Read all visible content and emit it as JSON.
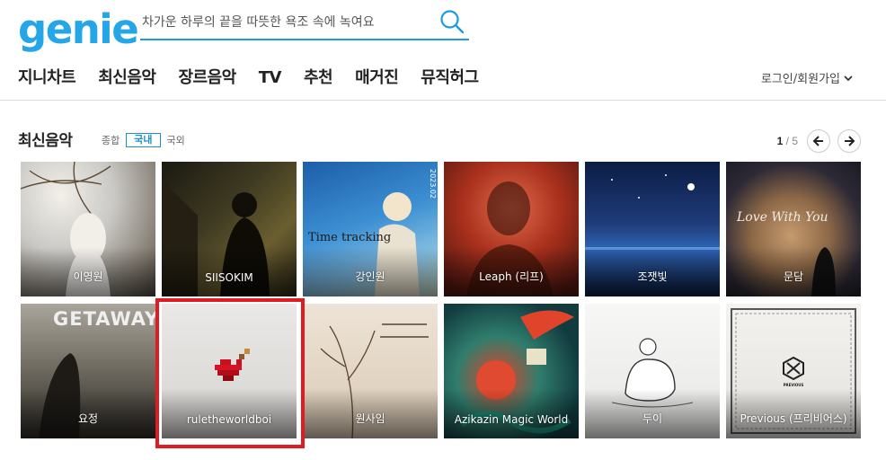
{
  "header": {
    "logo": "genie",
    "search_placeholder": "차가운 하루의 끝을 따뜻한 욕조 속에 녹여요"
  },
  "nav": {
    "items": [
      "지니차트",
      "최신음악",
      "장르음악",
      "TV",
      "추천",
      "매거진",
      "뮤직허그"
    ],
    "login": "로그인/회원가입"
  },
  "section": {
    "title": "최신음악",
    "filters": [
      "종합",
      "국내",
      "국외"
    ],
    "active_filter": "국내",
    "page_current": "1",
    "page_total": "/ 5"
  },
  "albums": [
    {
      "name": "이영원"
    },
    {
      "name": "SIISOKIM"
    },
    {
      "name": "강인원",
      "cover_text": "Time tracking",
      "cover_side": "2023.02"
    },
    {
      "name": "Leaph (리프)"
    },
    {
      "name": "조잿빛"
    },
    {
      "name": "문담",
      "cover_text": "Love With You"
    },
    {
      "name": "요정",
      "cover_text": "GETAWAY"
    },
    {
      "name": "ruletheworldboi"
    },
    {
      "name": "원사임"
    },
    {
      "name": "Azikazin Magic World"
    },
    {
      "name": "두이"
    },
    {
      "name": "Previous (프리비어스)",
      "cover_text": "PREVIOUS"
    }
  ],
  "colors": {
    "brand": "#24a6e7",
    "highlight": "#e01b22"
  }
}
